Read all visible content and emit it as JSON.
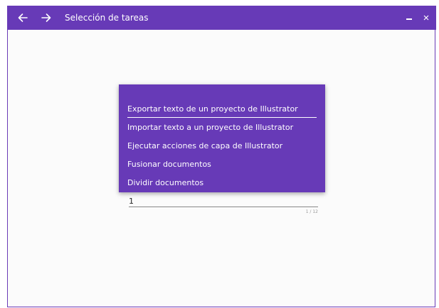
{
  "window": {
    "title": "Selección de tareas",
    "accent_color": "#673ab7",
    "back_icon": "arrow-left-icon",
    "forward_icon": "arrow-right-icon",
    "minimize_icon": "minimize-icon",
    "close_icon": "close-icon"
  },
  "menu": {
    "items": [
      {
        "label": "Exportar texto de un proyecto de Illustrator",
        "selected": true
      },
      {
        "label": "Importar texto a un proyecto de Illustrator",
        "selected": false
      },
      {
        "label": "Ejecutar acciones de capa de Illustrator",
        "selected": false
      },
      {
        "label": "Fusionar documentos",
        "selected": false
      },
      {
        "label": "Dividir documentos",
        "selected": false
      }
    ]
  },
  "input": {
    "value": "1",
    "counter": "1 / 12"
  }
}
